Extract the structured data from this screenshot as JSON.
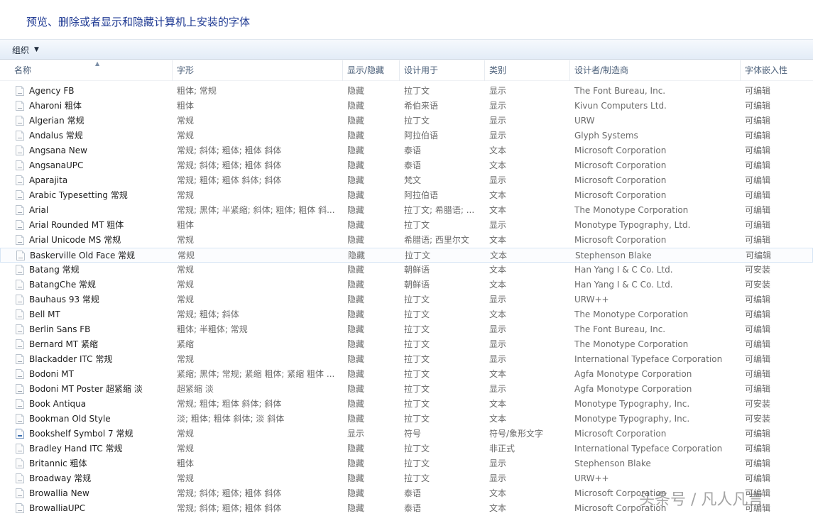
{
  "title": "预览、删除或者显示和隐藏计算机上安装的字体",
  "toolbar": {
    "organize_label": "组织"
  },
  "columns": [
    {
      "key": "name",
      "label": "名称"
    },
    {
      "key": "style",
      "label": "字形"
    },
    {
      "key": "visibility",
      "label": "显示/隐藏"
    },
    {
      "key": "designed_for",
      "label": "设计用于"
    },
    {
      "key": "category",
      "label": "类别"
    },
    {
      "key": "designer",
      "label": "设计者/制造商"
    },
    {
      "key": "embeddability",
      "label": "字体嵌入性"
    }
  ],
  "rows": [
    {
      "name": "Agency FB",
      "style": "粗体; 常规",
      "visibility": "隐藏",
      "designed_for": "拉丁文",
      "category": "显示",
      "designer": "The Font Bureau, Inc.",
      "embeddability": "可编辑"
    },
    {
      "name": "Aharoni 粗体",
      "style": "粗体",
      "visibility": "隐藏",
      "designed_for": "希伯来语",
      "category": "显示",
      "designer": "Kivun Computers Ltd.",
      "embeddability": "可编辑"
    },
    {
      "name": "Algerian 常规",
      "style": "常规",
      "visibility": "隐藏",
      "designed_for": "拉丁文",
      "category": "显示",
      "designer": "URW",
      "embeddability": "可编辑"
    },
    {
      "name": "Andalus 常规",
      "style": "常规",
      "visibility": "隐藏",
      "designed_for": "阿拉伯语",
      "category": "显示",
      "designer": "Glyph Systems",
      "embeddability": "可编辑"
    },
    {
      "name": "Angsana New",
      "style": "常规; 斜体; 粗体; 粗体 斜体",
      "visibility": "隐藏",
      "designed_for": "泰语",
      "category": "文本",
      "designer": "Microsoft Corporation",
      "embeddability": "可编辑"
    },
    {
      "name": "AngsanaUPC",
      "style": "常规; 斜体; 粗体; 粗体 斜体",
      "visibility": "隐藏",
      "designed_for": "泰语",
      "category": "文本",
      "designer": "Microsoft Corporation",
      "embeddability": "可编辑"
    },
    {
      "name": "Aparajita",
      "style": "常规; 粗体; 粗体 斜体; 斜体",
      "visibility": "隐藏",
      "designed_for": "梵文",
      "category": "显示",
      "designer": "Microsoft Corporation",
      "embeddability": "可编辑"
    },
    {
      "name": "Arabic Typesetting 常规",
      "style": "常规",
      "visibility": "隐藏",
      "designed_for": "阿拉伯语",
      "category": "文本",
      "designer": "Microsoft Corporation",
      "embeddability": "可编辑"
    },
    {
      "name": "Arial",
      "style": "常规; 黑体; 半紧缩; 斜体; 粗体; 粗体 斜...",
      "visibility": "隐藏",
      "designed_for": "拉丁文; 希腊语; ...",
      "category": "文本",
      "designer": "The Monotype Corporation",
      "embeddability": "可编辑"
    },
    {
      "name": "Arial Rounded MT 粗体",
      "style": "粗体",
      "visibility": "隐藏",
      "designed_for": "拉丁文",
      "category": "显示",
      "designer": "Monotype Typography, Ltd.",
      "embeddability": "可编辑"
    },
    {
      "name": "Arial Unicode MS 常规",
      "style": "常规",
      "visibility": "隐藏",
      "designed_for": "希腊语; 西里尔文",
      "category": "文本",
      "designer": "Microsoft Corporation",
      "embeddability": "可编辑"
    },
    {
      "name": "Baskerville Old Face 常规",
      "style": "常规",
      "visibility": "隐藏",
      "designed_for": "拉丁文",
      "category": "文本",
      "designer": "Stephenson Blake",
      "embeddability": "可编辑",
      "selected": true
    },
    {
      "name": "Batang 常规",
      "style": "常规",
      "visibility": "隐藏",
      "designed_for": "朝鲜语",
      "category": "文本",
      "designer": "Han Yang I & C Co. Ltd.",
      "embeddability": "可安装"
    },
    {
      "name": "BatangChe 常规",
      "style": "常规",
      "visibility": "隐藏",
      "designed_for": "朝鲜语",
      "category": "文本",
      "designer": "Han Yang I & C Co. Ltd.",
      "embeddability": "可安装"
    },
    {
      "name": "Bauhaus 93 常规",
      "style": "常规",
      "visibility": "隐藏",
      "designed_for": "拉丁文",
      "category": "显示",
      "designer": "URW++",
      "embeddability": "可编辑"
    },
    {
      "name": "Bell MT",
      "style": "常规; 粗体; 斜体",
      "visibility": "隐藏",
      "designed_for": "拉丁文",
      "category": "文本",
      "designer": "The Monotype Corporation",
      "embeddability": "可编辑"
    },
    {
      "name": "Berlin Sans FB",
      "style": "粗体; 半粗体; 常规",
      "visibility": "隐藏",
      "designed_for": "拉丁文",
      "category": "显示",
      "designer": "The Font Bureau, Inc.",
      "embeddability": "可编辑"
    },
    {
      "name": "Bernard MT 紧缩",
      "style": "紧缩",
      "visibility": "隐藏",
      "designed_for": "拉丁文",
      "category": "显示",
      "designer": "The Monotype Corporation",
      "embeddability": "可编辑"
    },
    {
      "name": "Blackadder ITC 常规",
      "style": "常规",
      "visibility": "隐藏",
      "designed_for": "拉丁文",
      "category": "显示",
      "designer": "International Typeface Corporation",
      "embeddability": "可编辑"
    },
    {
      "name": "Bodoni MT",
      "style": "紧缩; 黑体; 常规; 紧缩 粗体; 紧缩 粗体 ...",
      "visibility": "隐藏",
      "designed_for": "拉丁文",
      "category": "文本",
      "designer": "Agfa Monotype Corporation",
      "embeddability": "可编辑"
    },
    {
      "name": "Bodoni MT Poster 超紧缩 淡",
      "style": "超紧缩 淡",
      "visibility": "隐藏",
      "designed_for": "拉丁文",
      "category": "显示",
      "designer": "Agfa Monotype Corporation",
      "embeddability": "可编辑"
    },
    {
      "name": "Book Antiqua",
      "style": "常规; 粗体; 粗体 斜体; 斜体",
      "visibility": "隐藏",
      "designed_for": "拉丁文",
      "category": "文本",
      "designer": "Monotype Typography, Inc.",
      "embeddability": "可安装"
    },
    {
      "name": "Bookman Old Style",
      "style": "淡; 粗体; 粗体 斜体; 淡 斜体",
      "visibility": "隐藏",
      "designed_for": "拉丁文",
      "category": "文本",
      "designer": "Monotype Typography, Inc.",
      "embeddability": "可安装"
    },
    {
      "name": "Bookshelf Symbol 7 常规",
      "style": "常规",
      "visibility": "显示",
      "designed_for": "符号",
      "category": "符号/象形文字",
      "designer": "Microsoft Corporation",
      "embeddability": "可编辑",
      "symbol": true
    },
    {
      "name": "Bradley Hand ITC 常规",
      "style": "常规",
      "visibility": "隐藏",
      "designed_for": "拉丁文",
      "category": "非正式",
      "designer": "International Typeface Corporation",
      "embeddability": "可编辑"
    },
    {
      "name": "Britannic 粗体",
      "style": "粗体",
      "visibility": "隐藏",
      "designed_for": "拉丁文",
      "category": "显示",
      "designer": "Stephenson Blake",
      "embeddability": "可编辑"
    },
    {
      "name": "Broadway 常规",
      "style": "常规",
      "visibility": "隐藏",
      "designed_for": "拉丁文",
      "category": "显示",
      "designer": "URW++",
      "embeddability": "可编辑"
    },
    {
      "name": "Browallia New",
      "style": "常规; 斜体; 粗体; 粗体 斜体",
      "visibility": "隐藏",
      "designed_for": "泰语",
      "category": "文本",
      "designer": "Microsoft Corporation",
      "embeddability": "可编辑"
    },
    {
      "name": "BrowalliaUPC",
      "style": "常规; 斜体; 粗体; 粗体 斜体",
      "visibility": "隐藏",
      "designed_for": "泰语",
      "category": "文本",
      "designer": "Microsoft Corporation",
      "embeddability": "可编辑"
    }
  ],
  "watermark": "头条号 / 凡人凡言"
}
